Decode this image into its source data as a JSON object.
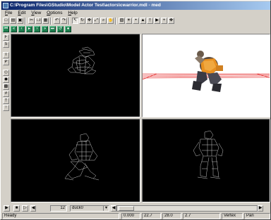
{
  "window": {
    "title": "C:\\Program Files\\GStudio\\Model Actor Test\\actors\\cwarrior.mdl - med"
  },
  "menu": [
    {
      "key": "F",
      "rest": "ile"
    },
    {
      "key": "E",
      "rest": "dit"
    },
    {
      "key": "V",
      "rest": "iew"
    },
    {
      "key": "O",
      "rest": "ptions"
    },
    {
      "key": "H",
      "rest": "elp"
    }
  ],
  "toolbar_icons": [
    "new-icon",
    "open-icon",
    "save-icon",
    "cut-icon",
    "copy-icon",
    "paste-icon",
    "undo-icon",
    "redo-icon",
    "select-icon",
    "rotate-icon",
    "move-icon",
    "scale-icon",
    "zoom-icon",
    "pan-icon",
    "texture-icon",
    "light-icon",
    "vertex-icon",
    "face-icon",
    "bone-icon",
    "animation-icon",
    "add-icon",
    "move-cross-icon"
  ],
  "anim_toolbar_icons": [
    "first-frame-icon",
    "prev-key-icon",
    "prev-frame-icon",
    "play-icon",
    "next-frame-icon",
    "next-key-icon",
    "last-frame-icon",
    "loop-icon",
    "record-icon"
  ],
  "left_toolbar_icons": [
    "view-front-icon",
    "view-side-icon",
    "view-top-icon",
    "view-persp-icon",
    "wireframe-icon",
    "solid-icon",
    "textured-icon",
    "grid-icon",
    "bones-icon",
    "normals-icon"
  ],
  "viewports": [
    {
      "name": "top-left-viewport",
      "mode": "wireframe"
    },
    {
      "name": "perspective-viewport",
      "mode": "textured"
    },
    {
      "name": "front-viewport",
      "mode": "wireframe"
    },
    {
      "name": "side-viewport",
      "mode": "wireframe"
    }
  ],
  "anim": {
    "frame": "12",
    "action": "duck0"
  },
  "status": {
    "message": "Ready",
    "x": "0.000",
    "y": "22.7",
    "z": "28.0",
    "w": "2.7",
    "mode": "Vertex",
    "tool": "Pan"
  },
  "colors": {
    "title_start": "#0a246a",
    "title_end": "#a6caf0",
    "wireframe": "#c8c8c8",
    "ground_line": "#e00000",
    "tool_green": "#1f7f4f"
  }
}
